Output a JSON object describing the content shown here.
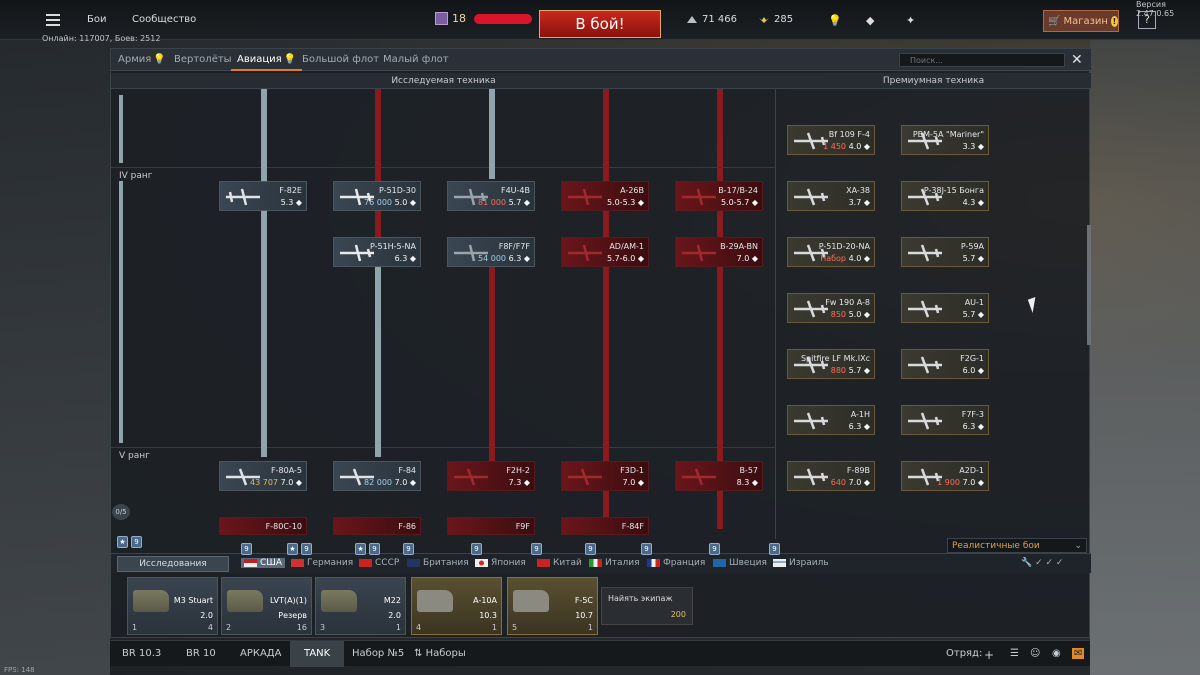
{
  "topbar": {
    "nav": [
      "Бои",
      "Сообщество"
    ],
    "online": "Онлайн: 117007, Боев: 2512",
    "player_level": "18",
    "battle_button": "В бой!",
    "silver": "71 466",
    "gold": "285",
    "shop": "Магазин",
    "shop_badge": "!",
    "help": "?",
    "version": "Версия 2.47.0.65"
  },
  "tabs": [
    "Армия",
    "Вертолёты",
    "Авиация",
    "Большой флот",
    "Малый флот"
  ],
  "search_placeholder": "Поиск...",
  "sections": {
    "research": "Исследуемая техника",
    "premium": "Премиумная техника"
  },
  "ranks": [
    "IV ранг",
    "V ранг"
  ],
  "tree": {
    "r4_row1": [
      {
        "name": "F-82E",
        "br": "5.3"
      },
      {
        "name": "P-51D-30",
        "cost": "76 000",
        "br": "5.0"
      },
      {
        "name": "F4U-4B",
        "cost": "81 000",
        "br": "5.7"
      },
      {
        "name": "A-26B",
        "br": "5.0-5.3"
      },
      {
        "name": "B-17/B-24",
        "br": "5.0-5.7"
      }
    ],
    "r4_row2": [
      {
        "name": "P-51H-5-NA",
        "br": "6.3"
      },
      {
        "name": "F8F/F7F",
        "cost": "54 000",
        "br": "6.3"
      },
      {
        "name": "AD/AM-1",
        "br": "5.7-6.0"
      },
      {
        "name": "B-29A-BN",
        "br": "7.0"
      }
    ],
    "r5_row1": [
      {
        "name": "F-80A-5",
        "cost": "43 707",
        "br": "7.0"
      },
      {
        "name": "F-84",
        "cost": "82 000",
        "br": "7.0"
      },
      {
        "name": "F2H-2",
        "br": "7.3"
      },
      {
        "name": "F3D-1",
        "br": "7.0"
      },
      {
        "name": "B-57",
        "br": "8.3"
      }
    ],
    "r5_row2": [
      {
        "name": "F-80C-10"
      },
      {
        "name": "F-86"
      },
      {
        "name": "F9F"
      },
      {
        "name": "F-84F"
      }
    ],
    "progress": "0/5"
  },
  "premium": [
    {
      "name": "Bf 109 F-4",
      "price": "1 450",
      "br": "4.0"
    },
    {
      "name": "PBM-5A \"Mariner\"",
      "br": "3.3"
    },
    {
      "name": "XA-38",
      "br": "3.7"
    },
    {
      "name": "P-38J-15 Бонга",
      "br": "4.3"
    },
    {
      "name": "P-51D-20-NA",
      "price": "Набор",
      "br": "4.0"
    },
    {
      "name": "P-59A",
      "br": "5.7"
    },
    {
      "name": "Fw 190 A-8",
      "price": "850",
      "br": "5.0"
    },
    {
      "name": "AU-1",
      "br": "5.7"
    },
    {
      "name": "Spitfire LF Mk.IXc",
      "price": "880",
      "br": "5.7"
    },
    {
      "name": "F2G-1",
      "br": "6.0"
    },
    {
      "name": "A-1H",
      "br": "6.3"
    },
    {
      "name": "F7F-3",
      "br": "6.3"
    },
    {
      "name": "F-89B",
      "price": "640",
      "br": "7.0"
    },
    {
      "name": "A2D-1",
      "price": "1 900",
      "br": "7.0"
    }
  ],
  "research_label": "Исследования",
  "battle_mode": "Реалистичные бои",
  "nations": [
    "США",
    "Германия",
    "СССР",
    "Британия",
    "Япония",
    "Китай",
    "Италия",
    "Франция",
    "Швеция",
    "Израиль"
  ],
  "crew": [
    {
      "name": "M3 Stuart",
      "br": "2.0",
      "slot": "1",
      "rating": "4"
    },
    {
      "name": "LVT(A)(1)",
      "br": "Резерв",
      "slot": "2",
      "rating": "16"
    },
    {
      "name": "M22",
      "br": "2.0",
      "slot": "3",
      "rating": "1"
    },
    {
      "name": "A-10A",
      "br": "10.3",
      "slot": "4",
      "rating": "1"
    },
    {
      "name": "F-5C",
      "br": "10.7",
      "slot": "5",
      "rating": "1"
    }
  ],
  "hire_crew": {
    "label": "Найять экипаж",
    "cost": "200"
  },
  "bottom": {
    "modes": [
      "BR 10.3",
      "BR 10",
      "АРКАДА",
      "TANK",
      "Набор №5",
      "Наборы"
    ],
    "squad": "Отряд:"
  },
  "fps": "FPS: 148",
  "colors": {
    "accent": "#e07d2a",
    "locked": "#6a161a",
    "battle": "#c9281e"
  }
}
